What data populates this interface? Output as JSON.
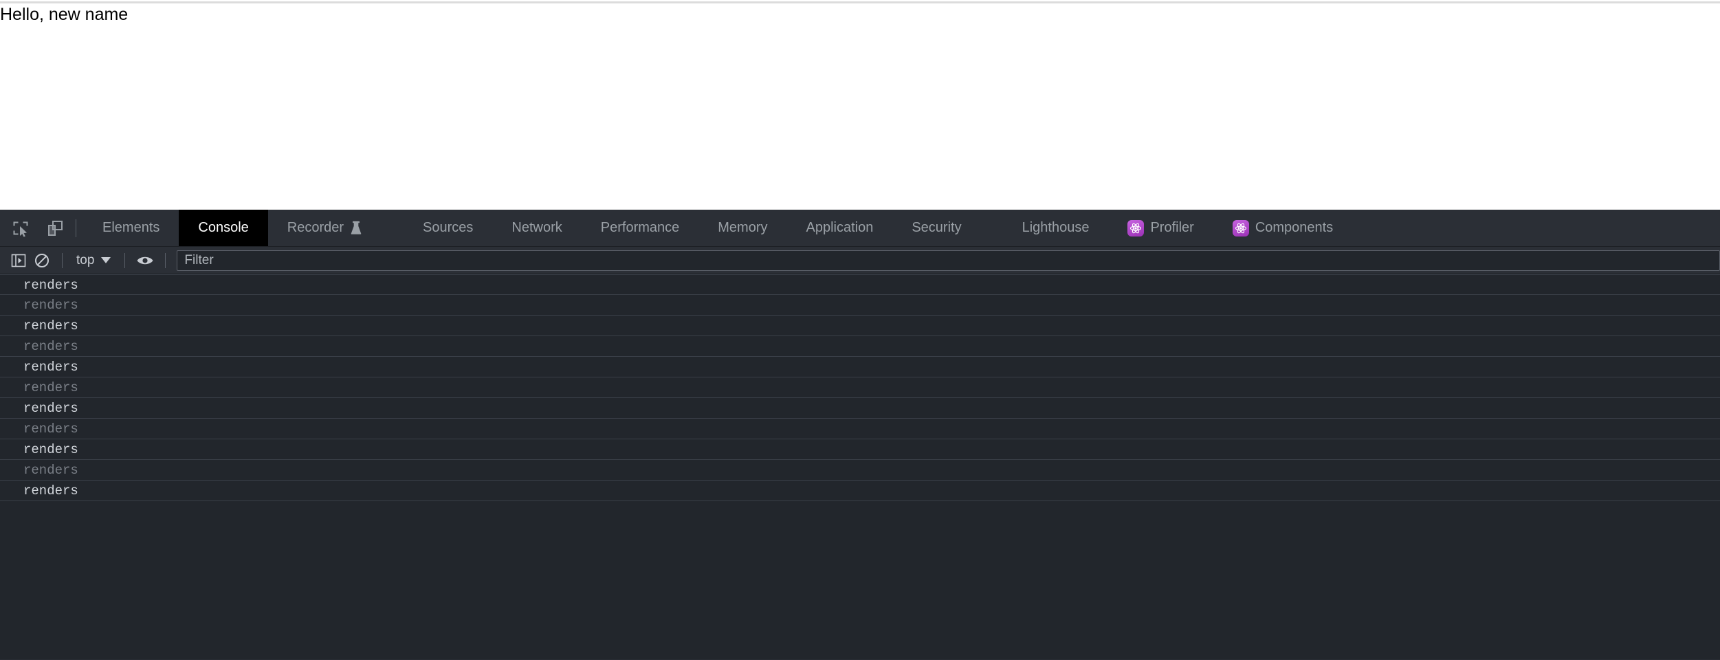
{
  "page": {
    "heading": "Hello, new name"
  },
  "devtools": {
    "left_tools": [
      {
        "name": "inspect-element-icon",
        "label": "Inspect element"
      },
      {
        "name": "device-toolbar-icon",
        "label": "Toggle device toolbar"
      }
    ],
    "tabs": [
      {
        "label": "Elements",
        "selected": false,
        "icon": null
      },
      {
        "label": "Console",
        "selected": true,
        "icon": null
      },
      {
        "label": "Recorder",
        "selected": false,
        "icon": "flask-icon"
      },
      {
        "label": "Sources",
        "selected": false,
        "icon": null
      },
      {
        "label": "Network",
        "selected": false,
        "icon": null
      },
      {
        "label": "Performance",
        "selected": false,
        "icon": null
      },
      {
        "label": "Memory",
        "selected": false,
        "icon": null
      },
      {
        "label": "Application",
        "selected": false,
        "icon": null
      },
      {
        "label": "Security",
        "selected": false,
        "icon": null
      },
      {
        "label": "Lighthouse",
        "selected": false,
        "icon": null
      },
      {
        "label": "Profiler",
        "selected": false,
        "icon": "react-badge"
      },
      {
        "label": "Components",
        "selected": false,
        "icon": "react-badge"
      }
    ],
    "console_toolbar": {
      "sidebar_toggle": "Show console sidebar",
      "clear_console": "Clear console",
      "context": "top",
      "live_expression": "Create live expression",
      "filter_placeholder": "Filter",
      "filter_value": ""
    },
    "console_messages": [
      {
        "text": "renders",
        "style": "bright"
      },
      {
        "text": "renders",
        "style": "dim"
      },
      {
        "text": "renders",
        "style": "bright"
      },
      {
        "text": "renders",
        "style": "dim"
      },
      {
        "text": "renders",
        "style": "bright"
      },
      {
        "text": "renders",
        "style": "dim"
      },
      {
        "text": "renders",
        "style": "bright"
      },
      {
        "text": "renders",
        "style": "dim"
      },
      {
        "text": "renders",
        "style": "bright"
      },
      {
        "text": "renders",
        "style": "dim"
      },
      {
        "text": "renders",
        "style": "bright"
      }
    ]
  },
  "colors": {
    "page_bg": "#ffffff",
    "devtools_chrome": "#2b2f36",
    "console_bg": "#22262c",
    "selected_tab_bg": "#000000",
    "tab_text": "#9aa0a6",
    "message_bright": "#d2d6dc",
    "message_dim": "#7a7f87",
    "react_purple": "#9b30b5",
    "row_separator": "#3a3f48"
  }
}
